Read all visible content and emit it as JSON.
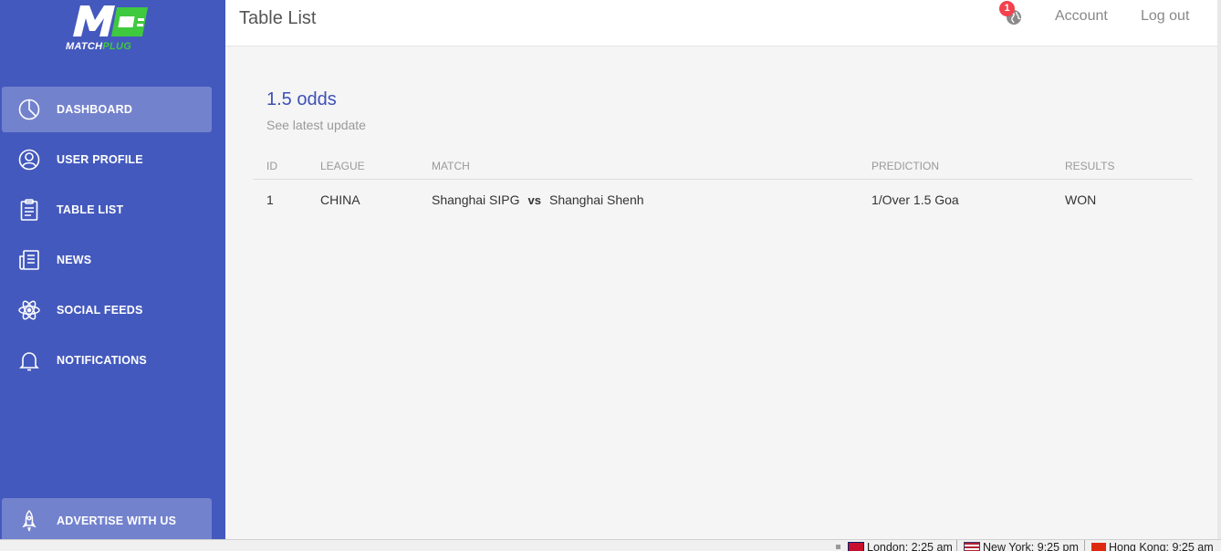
{
  "brand": {
    "name_part1": "MATCH",
    "name_part2": "PLUG",
    "accent": "#3fc93f",
    "sidebar_color": "#4459bd"
  },
  "sidebar": {
    "items": [
      {
        "label": "DASHBOARD",
        "icon": "pie-chart-icon",
        "active": true
      },
      {
        "label": "USER PROFILE",
        "icon": "user-icon",
        "active": false
      },
      {
        "label": "TABLE LIST",
        "icon": "clipboard-icon",
        "active": false
      },
      {
        "label": "NEWS",
        "icon": "newspaper-icon",
        "active": false
      },
      {
        "label": "SOCIAL FEEDS",
        "icon": "atom-icon",
        "active": false
      },
      {
        "label": "NOTIFICATIONS",
        "icon": "bell-icon",
        "active": false
      }
    ],
    "advertise": {
      "label": "ADVERTISE WITH US",
      "icon": "rocket-icon"
    }
  },
  "header": {
    "title": "Table List",
    "notification_count": "1",
    "account_label": "Account",
    "logout_label": "Log out"
  },
  "section": {
    "title": "1.5 odds",
    "subtitle": "See latest update"
  },
  "table": {
    "columns": [
      "ID",
      "LEAGUE",
      "MATCH",
      "PREDICTION",
      "RESULTS"
    ],
    "rows": [
      {
        "id": "1",
        "league": "CHINA",
        "home": "Shanghai SIPG",
        "vs": "vs",
        "away": "Shanghai Shenh",
        "prediction": "1/Over 1.5 Goa",
        "result": "WON"
      }
    ]
  },
  "statusbar": {
    "clocks": [
      {
        "label": "London: 2:25 am"
      },
      {
        "label": "New York: 9:25 pm"
      },
      {
        "label": "Hong Kong: 9:25 am"
      }
    ]
  }
}
